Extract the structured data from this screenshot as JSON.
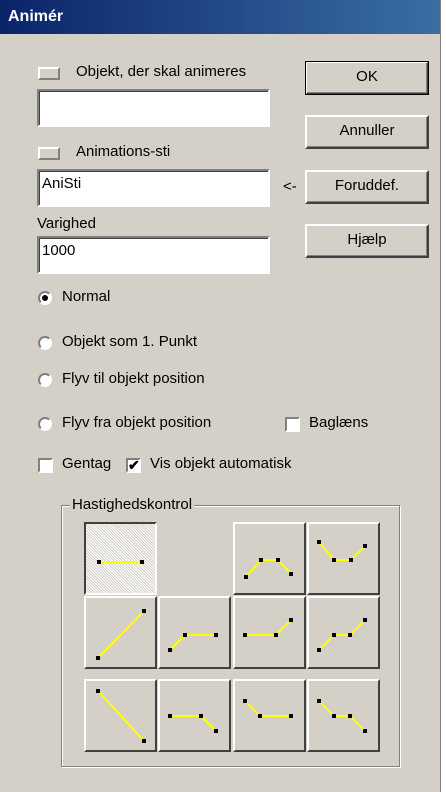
{
  "dialog": {
    "title": "Animér"
  },
  "object": {
    "label": "Objekt, der skal animeres",
    "value": ""
  },
  "path": {
    "label": "Animations-sti",
    "value": "AniSti",
    "arrow": "<-"
  },
  "duration": {
    "label": "Varighed",
    "value": "1000"
  },
  "buttons": {
    "ok": "OK",
    "cancel": "Annuller",
    "predef": "Foruddef.",
    "help": "Hjælp"
  },
  "modes": {
    "selected": "Normal",
    "options": [
      "Normal",
      "Objekt som 1. Punkt",
      "Flyv til objekt position",
      "Flyv fra objekt position"
    ]
  },
  "checks": {
    "reverse": {
      "label": "Baglæns",
      "checked": false
    },
    "repeat": {
      "label": "Gentag",
      "checked": false
    },
    "auto_show": {
      "label": "Vis objekt automatisk",
      "checked": true
    }
  },
  "speed_group": {
    "label": "Hastighedskontrol",
    "selected": "constant",
    "line_color": "#ffff00",
    "tiles": [
      "constant",
      "up-plateau-down",
      "down-plateau-up",
      "linear-up",
      "ease-in-up",
      "flat-then-up",
      "step-up",
      "linear-down",
      "step-down",
      "flat-then-down",
      "down-then-flat"
    ]
  }
}
